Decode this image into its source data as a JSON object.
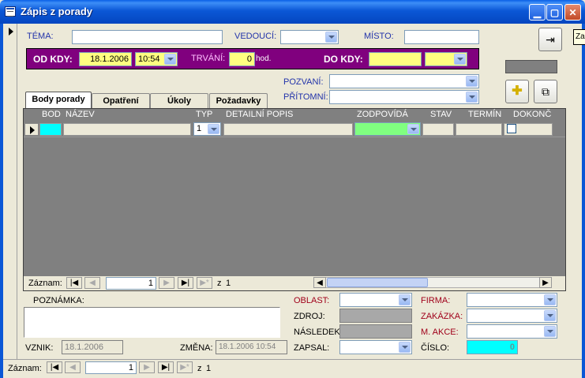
{
  "window": {
    "title": "Zápis z porady"
  },
  "header": {
    "tema_label": "TÉMA:",
    "tema_value": "",
    "vedouci_label": "VEDOUCÍ:",
    "vedouci_value": "",
    "misto_label": "MÍSTO:",
    "misto_value": "",
    "od_kdy_label": "OD KDY:",
    "od_date": "18.1.2006",
    "od_time": "10:54",
    "trvani_label": "TRVÁNÍ:",
    "trvani_value": "0",
    "trvani_unit": "hod.",
    "do_kdy_label": "DO KDY:",
    "do_date": "",
    "do_time": "",
    "pozvani_label": "POZVANÍ:",
    "pritomni_label": "PŘÍTOMNÍ:"
  },
  "tabs": [
    {
      "label": "Body porady",
      "active": true
    },
    {
      "label": "Opatření",
      "active": false
    },
    {
      "label": "Úkoly",
      "active": false
    },
    {
      "label": "Požadavky",
      "active": false
    }
  ],
  "grid": {
    "columns": [
      "BOD",
      "NÁZEV",
      "TYP",
      "DETAILNÍ POPIS",
      "ZODPOVÍDÁ",
      "STAV",
      "TERMÍN",
      "DOKONČ"
    ],
    "row": {
      "typ": "1"
    },
    "colors": {
      "bod_cell": "#00ffff",
      "zodpovida_cell": "#80ff80"
    }
  },
  "subnav": {
    "label": "Záznam:",
    "current": "1",
    "total_prefix": "z",
    "total": "1"
  },
  "bottom": {
    "poznamka_label": "POZNÁMKA:",
    "oblast_label": "OBLAST:",
    "zdroj_label": "ZDROJ:",
    "nasledek_label": "NÁSLEDEK:",
    "zapsal_label": "ZAPSAL:",
    "firma_label": "FIRMA:",
    "zakazka_label": "ZAKÁZKA:",
    "m_akce_label": "M. AKCE:",
    "cislo_label": "ČÍSLO:",
    "cislo_value": "0",
    "vznik_label": "VZNIK:",
    "vznik_value": "18.1.2006",
    "zmena_label": "ZMĚNA:",
    "zmena_value": "18.1.2006 10:54"
  },
  "mainnav": {
    "label": "Záznam:",
    "current": "1",
    "total_prefix": "z",
    "total": "1"
  },
  "tooltip": {
    "text": "Za"
  },
  "colors": {
    "purple": "#80007e",
    "yellow": "#ffff80",
    "cyan": "#00ffff"
  }
}
